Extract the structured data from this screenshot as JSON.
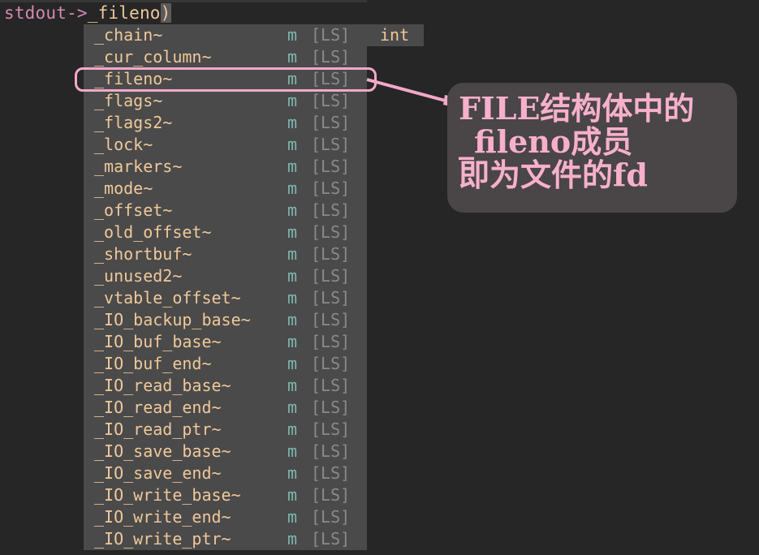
{
  "editor": {
    "cmdline": {
      "variable": "stdout",
      "operator": "->",
      "member": "_fileno",
      "paren": ")"
    }
  },
  "completion": {
    "type_info": "int",
    "items": [
      {
        "word": "_chain~",
        "kind": "m",
        "menu": "[LS]"
      },
      {
        "word": "_cur_column~",
        "kind": "m",
        "menu": "[LS]"
      },
      {
        "word": "_fileno~",
        "kind": "m",
        "menu": "[LS]"
      },
      {
        "word": "_flags~",
        "kind": "m",
        "menu": "[LS]"
      },
      {
        "word": "_flags2~",
        "kind": "m",
        "menu": "[LS]"
      },
      {
        "word": "_lock~",
        "kind": "m",
        "menu": "[LS]"
      },
      {
        "word": "_markers~",
        "kind": "m",
        "menu": "[LS]"
      },
      {
        "word": "_mode~",
        "kind": "m",
        "menu": "[LS]"
      },
      {
        "word": "_offset~",
        "kind": "m",
        "menu": "[LS]"
      },
      {
        "word": "_old_offset~",
        "kind": "m",
        "menu": "[LS]"
      },
      {
        "word": "_shortbuf~",
        "kind": "m",
        "menu": "[LS]"
      },
      {
        "word": "_unused2~",
        "kind": "m",
        "menu": "[LS]"
      },
      {
        "word": "_vtable_offset~",
        "kind": "m",
        "menu": "[LS]"
      },
      {
        "word": "_IO_backup_base~",
        "kind": "m",
        "menu": "[LS]"
      },
      {
        "word": "_IO_buf_base~",
        "kind": "m",
        "menu": "[LS]"
      },
      {
        "word": "_IO_buf_end~",
        "kind": "m",
        "menu": "[LS]"
      },
      {
        "word": "_IO_read_base~",
        "kind": "m",
        "menu": "[LS]"
      },
      {
        "word": "_IO_read_end~",
        "kind": "m",
        "menu": "[LS]"
      },
      {
        "word": "_IO_read_ptr~",
        "kind": "m",
        "menu": "[LS]"
      },
      {
        "word": "_IO_save_base~",
        "kind": "m",
        "menu": "[LS]"
      },
      {
        "word": "_IO_save_end~",
        "kind": "m",
        "menu": "[LS]"
      },
      {
        "word": "_IO_write_base~",
        "kind": "m",
        "menu": "[LS]"
      },
      {
        "word": "_IO_write_end~",
        "kind": "m",
        "menu": "[LS]"
      },
      {
        "word": "_IO_write_ptr~",
        "kind": "m",
        "menu": "[LS]"
      }
    ]
  },
  "annotation": {
    "lines": [
      "FILE结构体中的",
      "_fileno成员",
      "即为文件的fd"
    ],
    "color": "#f7b0cc"
  }
}
